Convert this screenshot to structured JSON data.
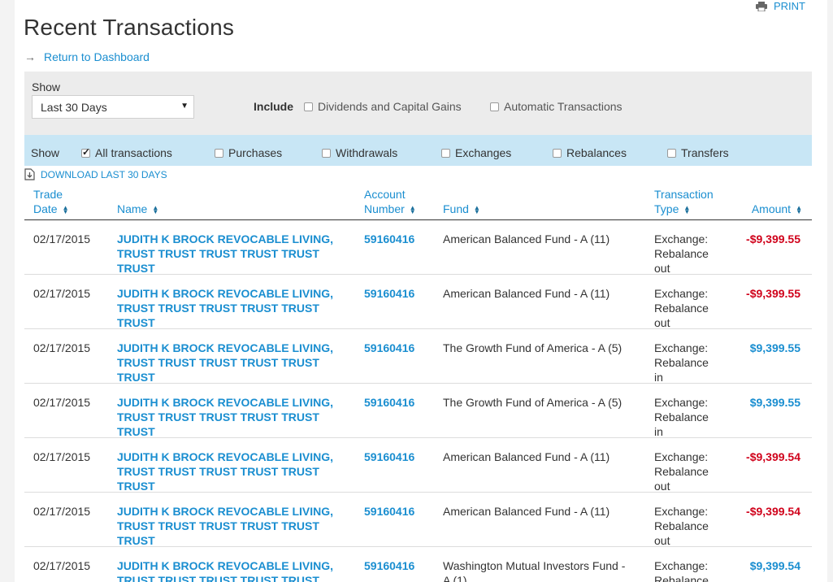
{
  "header": {
    "print_label": "PRINT",
    "title": "Recent Transactions",
    "back_link": "Return to Dashboard"
  },
  "filters": {
    "show_label": "Show",
    "period_selected": "Last 30 Days",
    "include_label": "Include",
    "include_options": [
      {
        "label": "Dividends and Capital Gains",
        "checked": false
      },
      {
        "label": "Automatic Transactions",
        "checked": false
      }
    ]
  },
  "type_filter": {
    "show_label": "Show",
    "options": [
      {
        "label": "All transactions",
        "checked": true
      },
      {
        "label": "Purchases",
        "checked": false
      },
      {
        "label": "Withdrawals",
        "checked": false
      },
      {
        "label": "Exchanges",
        "checked": false
      },
      {
        "label": "Rebalances",
        "checked": false
      },
      {
        "label": "Transfers",
        "checked": false
      }
    ]
  },
  "download_label": "DOWNLOAD LAST 30 DAYS",
  "table": {
    "headers": {
      "trade_date_1": "Trade",
      "trade_date_2": "Date",
      "name": "Name",
      "account_1": "Account",
      "account_2": "Number",
      "fund": "Fund",
      "type_1": "Transaction",
      "type_2": "Type",
      "amount": "Amount"
    },
    "rows": [
      {
        "date": "02/17/2015",
        "name_1": "JUDITH K BROCK REVOCABLE LIVING,",
        "name_2": "TRUST TRUST TRUST TRUST TRUST TRUST",
        "account": "59160416",
        "fund_1": "American Balanced Fund - A (11)",
        "fund_2": "",
        "type_1": "Exchange:",
        "type_2": "Rebalance",
        "type_3": "out",
        "amount": "-$9,399.55",
        "sign": "neg"
      },
      {
        "date": "02/17/2015",
        "name_1": "JUDITH K BROCK REVOCABLE LIVING,",
        "name_2": "TRUST TRUST TRUST TRUST TRUST TRUST",
        "account": "59160416",
        "fund_1": "American Balanced Fund - A (11)",
        "fund_2": "",
        "type_1": "Exchange:",
        "type_2": "Rebalance",
        "type_3": "out",
        "amount": "-$9,399.55",
        "sign": "neg"
      },
      {
        "date": "02/17/2015",
        "name_1": "JUDITH K BROCK REVOCABLE LIVING,",
        "name_2": "TRUST TRUST TRUST TRUST TRUST TRUST",
        "account": "59160416",
        "fund_1": "The Growth Fund of America - A (5)",
        "fund_2": "",
        "type_1": "Exchange:",
        "type_2": "Rebalance",
        "type_3": "in",
        "amount": "$9,399.55",
        "sign": "pos"
      },
      {
        "date": "02/17/2015",
        "name_1": "JUDITH K BROCK REVOCABLE LIVING,",
        "name_2": "TRUST TRUST TRUST TRUST TRUST TRUST",
        "account": "59160416",
        "fund_1": "The Growth Fund of America - A (5)",
        "fund_2": "",
        "type_1": "Exchange:",
        "type_2": "Rebalance",
        "type_3": "in",
        "amount": "$9,399.55",
        "sign": "pos"
      },
      {
        "date": "02/17/2015",
        "name_1": "JUDITH K BROCK REVOCABLE LIVING,",
        "name_2": "TRUST TRUST TRUST TRUST TRUST TRUST",
        "account": "59160416",
        "fund_1": "American Balanced Fund - A (11)",
        "fund_2": "",
        "type_1": "Exchange:",
        "type_2": "Rebalance",
        "type_3": "out",
        "amount": "-$9,399.54",
        "sign": "neg"
      },
      {
        "date": "02/17/2015",
        "name_1": "JUDITH K BROCK REVOCABLE LIVING,",
        "name_2": "TRUST TRUST TRUST TRUST TRUST TRUST",
        "account": "59160416",
        "fund_1": "American Balanced Fund - A (11)",
        "fund_2": "",
        "type_1": "Exchange:",
        "type_2": "Rebalance",
        "type_3": "out",
        "amount": "-$9,399.54",
        "sign": "neg"
      },
      {
        "date": "02/17/2015",
        "name_1": "JUDITH K BROCK REVOCABLE LIVING,",
        "name_2": "TRUST TRUST TRUST TRUST TRUST TRUST",
        "account": "59160416",
        "fund_1": "Washington Mutual Investors Fund -",
        "fund_2": "A (1)",
        "type_1": "Exchange:",
        "type_2": "Rebalance",
        "type_3": "",
        "amount": "$9,399.54",
        "sign": "pos"
      }
    ]
  },
  "colors": {
    "link": "#1a8ed0",
    "negative": "#d0021b",
    "filter_bg": "#ececec",
    "type_bar_bg": "#c8e6f5"
  }
}
